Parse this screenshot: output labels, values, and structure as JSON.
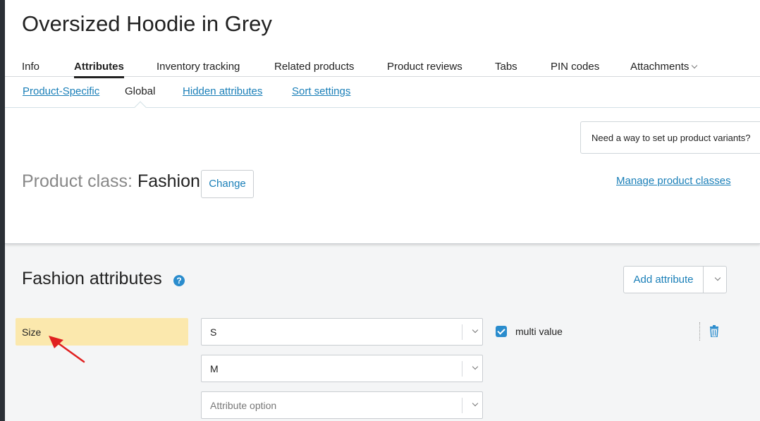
{
  "product": {
    "title": "Oversized Hoodie in Grey"
  },
  "tabs": [
    {
      "label": "Info"
    },
    {
      "label": "Attributes"
    },
    {
      "label": "Inventory tracking"
    },
    {
      "label": "Related products"
    },
    {
      "label": "Product reviews"
    },
    {
      "label": "Tabs"
    },
    {
      "label": "PIN codes"
    },
    {
      "label": "Attachments"
    }
  ],
  "subtabs": [
    {
      "label": "Product-Specific"
    },
    {
      "label": "Global"
    },
    {
      "label": "Hidden attributes"
    },
    {
      "label": "Sort settings"
    }
  ],
  "variants_box": {
    "text": "Need a way to set up product variants?"
  },
  "product_class": {
    "label": "Product class:",
    "value": "Fashion",
    "change_label": "Change",
    "manage_link": "Manage product classes"
  },
  "attributes": {
    "title": "Fashion attributes",
    "help_icon_glyph": "?",
    "add_label": "Add attribute",
    "size": {
      "label": "Size",
      "values": [
        "S",
        "M"
      ],
      "option_placeholder": "Attribute option",
      "multi_value_label": "multi value",
      "multi_value_checked": true
    }
  },
  "colors": {
    "accent": "#1a7fb8",
    "highlight": "#fbe8ad",
    "annotation_arrow": "#e02020"
  },
  "icons": [
    "chevron-down-icon",
    "help-icon",
    "checkmark-icon",
    "trash-icon",
    "annotation-arrow-icon"
  ]
}
